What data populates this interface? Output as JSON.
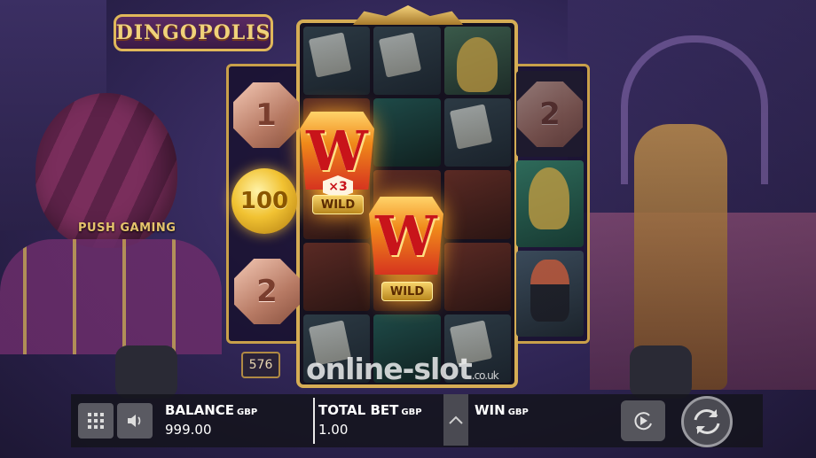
{
  "game": {
    "logo": "DINGOPOLIS",
    "casino_sign": "PUSH GAMING",
    "ways": "576"
  },
  "collect_coins": {
    "left": [
      "1",
      "100",
      "2"
    ],
    "right": [
      "2"
    ]
  },
  "wilds": [
    {
      "label": "WILD",
      "multiplier": "×3"
    },
    {
      "label": "WILD",
      "multiplier": ""
    }
  ],
  "watermark": {
    "text": "online-slot",
    "suffix": ".co.uk"
  },
  "bottom_bar": {
    "balance": {
      "label": "BALANCE",
      "currency": "GBP",
      "value": "999.00"
    },
    "total_bet": {
      "label": "TOTAL BET",
      "currency": "GBP",
      "value": "1.00"
    },
    "win": {
      "label": "WIN",
      "currency": "GBP",
      "value": ""
    },
    "icons": {
      "menu": "grid-icon",
      "sound": "speaker-icon",
      "bet_up": "chevron-up-icon",
      "autoplay": "autoplay-icon",
      "spin": "spin-icon"
    }
  },
  "colors": {
    "frame_gold": "#d6ad55",
    "wild_red": "#c8141a",
    "coin_gold": "#f1c232",
    "coin_copper": "#b77a64",
    "bar_bg": "#14141c"
  }
}
